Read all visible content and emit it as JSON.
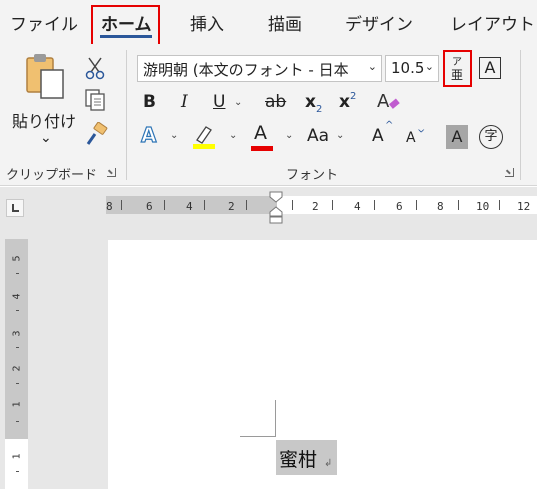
{
  "tabs": [
    "ファイル",
    "ホーム",
    "挿入",
    "描画",
    "デザイン",
    "レイアウト"
  ],
  "active_tab": "ホーム",
  "colors": {
    "highlight_red_box": "#e60000",
    "active_tab_underline": "#2b579a",
    "highlighter_yellow": "#ffff00",
    "font_color_red": "#e60000",
    "text_effects_blue": "#2e75b6",
    "eraser_pink": "#c05ccf"
  },
  "clipboard": {
    "paste_label": "貼り付け",
    "paste_dropdown": "⌄",
    "group_label": "クリップボード"
  },
  "font": {
    "font_name": "游明朝 (本文のフォント - 日本",
    "font_size": "10.5",
    "ruby_top": "ア",
    "ruby_bottom": "亜",
    "enclosed_char": "A",
    "bold": "B",
    "italic": "I",
    "underline": "U",
    "strikethrough": "ab",
    "subscript": "x",
    "subscript_sub": "2",
    "superscript": "x",
    "superscript_sup": "2",
    "text_effects": "A",
    "font_color": "A",
    "change_case": "Aa",
    "grow_font": "A",
    "shrink_font": "A",
    "char_shading": "A",
    "enclose_char": "字",
    "group_label": "フォント"
  },
  "ruler": {
    "left_labels": [
      "8",
      "6",
      "4",
      "2"
    ],
    "right_labels": [
      "2",
      "4",
      "6",
      "8",
      "10",
      "12"
    ],
    "vertical_labels": [
      "5",
      "4",
      "3",
      "2",
      "1",
      "1"
    ]
  },
  "document": {
    "text": "蜜柑",
    "paragraph_mark": "↲"
  }
}
